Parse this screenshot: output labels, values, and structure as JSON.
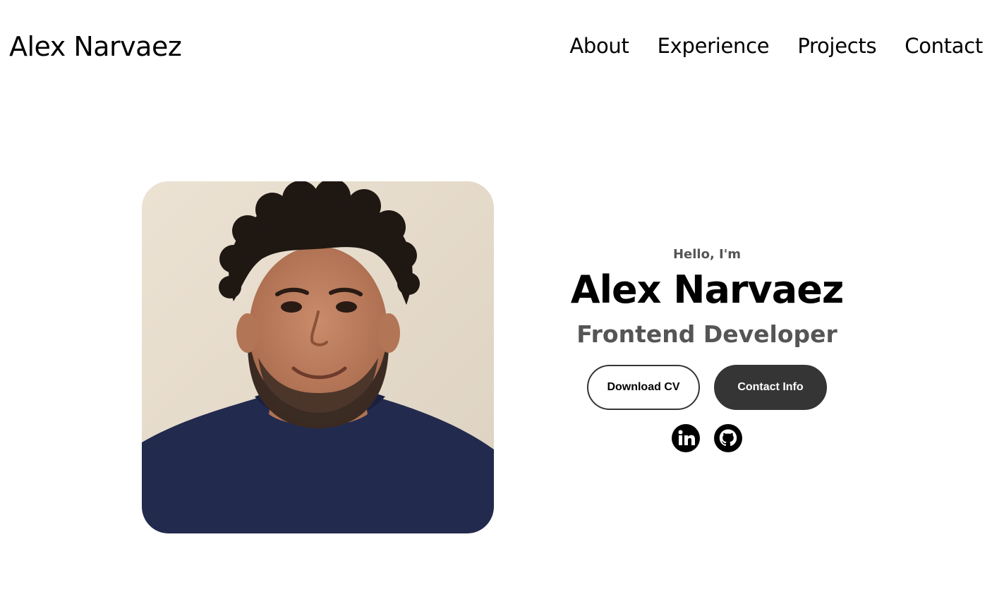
{
  "nav": {
    "logo": "Alex Narvaez",
    "links": [
      {
        "label": "About"
      },
      {
        "label": "Experience"
      },
      {
        "label": "Projects"
      },
      {
        "label": "Contact"
      }
    ]
  },
  "hero": {
    "greeting": "Hello, I'm",
    "name": "Alex Narvaez",
    "role": "Frontend Developer",
    "buttons": {
      "download_cv": "Download CV",
      "contact_info": "Contact Info"
    },
    "socials": [
      {
        "icon": "linkedin-icon"
      },
      {
        "icon": "github-icon"
      }
    ],
    "portrait_icon": "profile-photo"
  },
  "colors": {
    "text": "#000000",
    "muted": "#555555",
    "button_dark": "#353535",
    "background": "#ffffff"
  }
}
